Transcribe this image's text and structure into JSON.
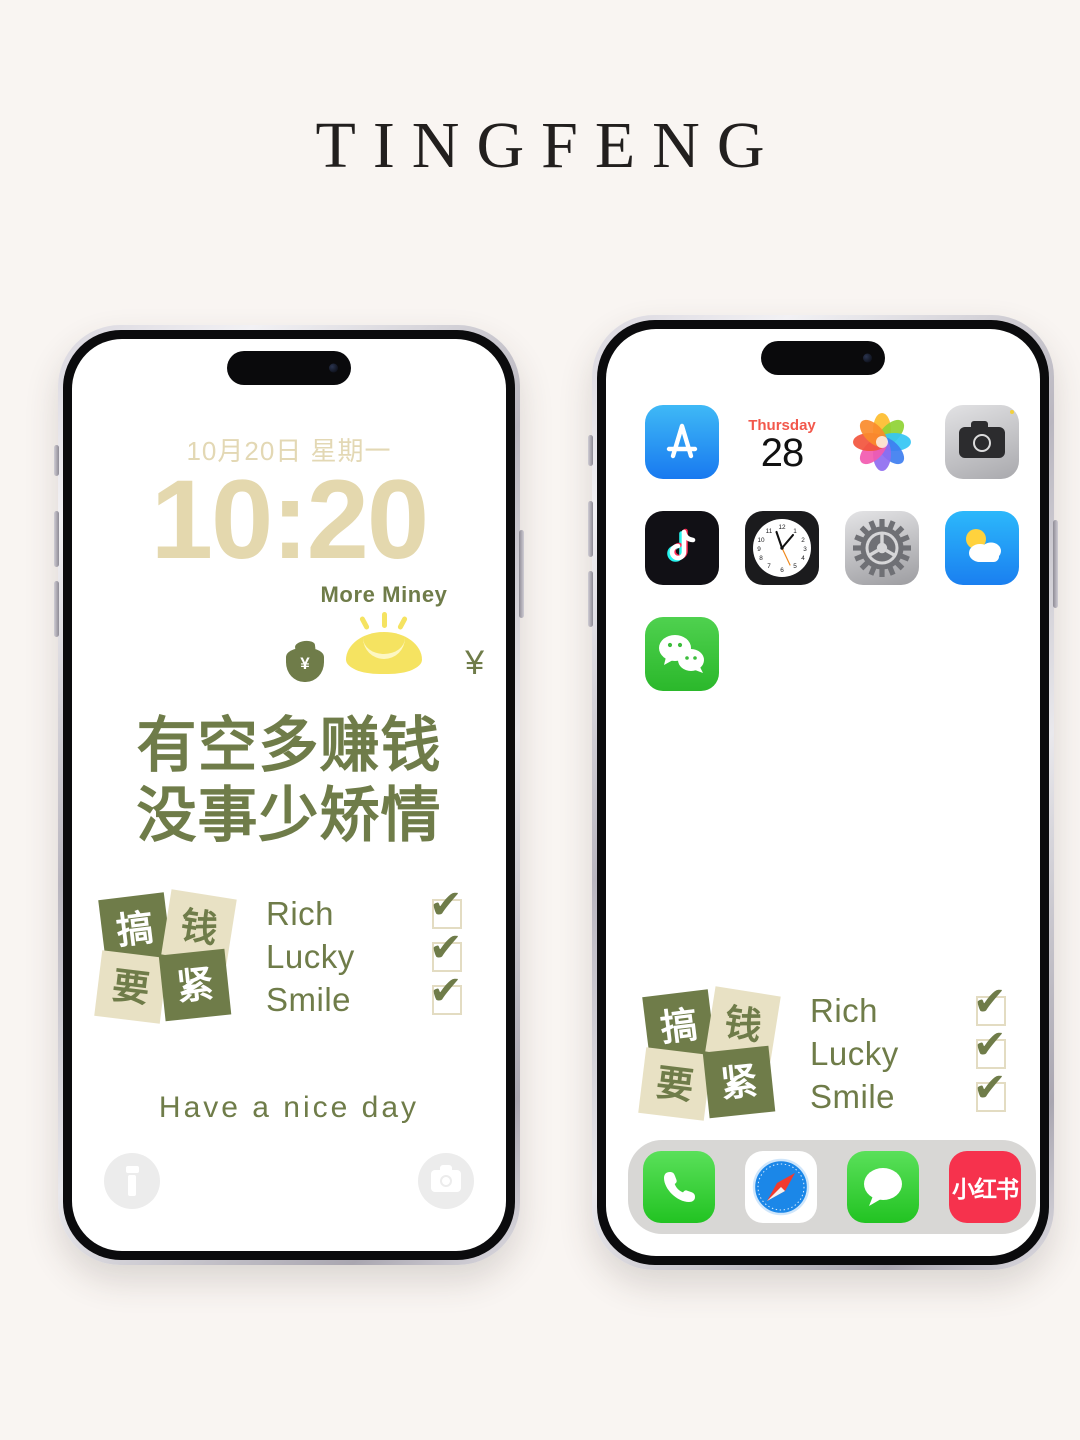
{
  "brand": {
    "title": "TINGFENG"
  },
  "lock_screen": {
    "date": "10月20日 星期一",
    "time": "10:20",
    "widget": {
      "label": "More Miney",
      "bag_symbol": "¥",
      "yen_symbol": "¥"
    },
    "slogan_line1": "有空多赚钱",
    "slogan_line2": "没事少矫情",
    "footer": "Have a nice day",
    "controls": [
      {
        "name": "flashlight",
        "label": "Flashlight"
      },
      {
        "name": "camera",
        "label": "Camera"
      }
    ]
  },
  "stickers": {
    "tiles": [
      {
        "char": "搞",
        "style": "dark"
      },
      {
        "char": "钱",
        "style": "light"
      },
      {
        "char": "要",
        "style": "light"
      },
      {
        "char": "紧",
        "style": "dark"
      }
    ],
    "checklist": [
      {
        "label": "Rich",
        "checked": true,
        "mark": "✔"
      },
      {
        "label": "Lucky",
        "checked": true,
        "mark": "✔"
      },
      {
        "label": "Smile",
        "checked": true,
        "mark": "✔"
      }
    ]
  },
  "home_screen": {
    "apps": [
      {
        "name": "App Store",
        "icon": "appstore-icon"
      },
      {
        "name": "Calendar",
        "icon": "calendar-icon",
        "weekday": "Thursday",
        "date": "28"
      },
      {
        "name": "Photos",
        "icon": "photos-icon"
      },
      {
        "name": "Camera",
        "icon": "camera-icon"
      },
      {
        "name": "TikTok",
        "icon": "tiktok-icon"
      },
      {
        "name": "Clock",
        "icon": "clock-icon"
      },
      {
        "name": "Settings",
        "icon": "settings-icon"
      },
      {
        "name": "Weather",
        "icon": "weather-icon"
      },
      {
        "name": "WeChat",
        "icon": "wechat-icon"
      }
    ],
    "dock": [
      {
        "name": "Phone",
        "icon": "phone-icon"
      },
      {
        "name": "Safari",
        "icon": "safari-icon"
      },
      {
        "name": "Messages",
        "icon": "messages-icon"
      },
      {
        "name": "小红书",
        "icon": "xiaohongshu-icon",
        "label": "小红书"
      }
    ]
  },
  "colors": {
    "page_background": "#f9f5f2",
    "olive": "#6f7c49",
    "beige": "#e8e1c4",
    "clock_beige": "#e4d8ae",
    "brand_text": "#221f1e"
  }
}
